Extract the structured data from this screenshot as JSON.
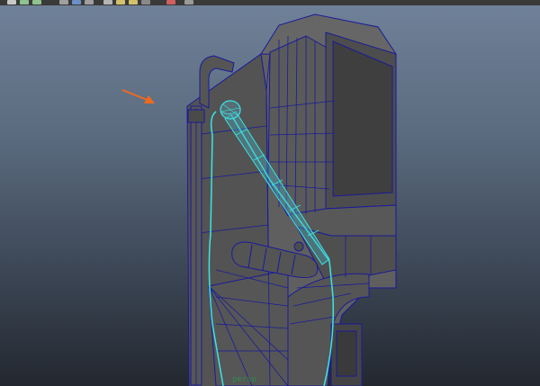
{
  "toolbar": {
    "icons": [
      "shelf-icon-1",
      "shelf-icon-2",
      "shelf-icon-3",
      "display-mode-icon-1",
      "display-mode-icon-2",
      "display-mode-icon-3",
      "lighting-icon-1",
      "lighting-icon-2",
      "lighting-icon-3",
      "camera-icon",
      "isolate-icon",
      "xray-icon"
    ]
  },
  "viewport": {
    "label_text": "persp",
    "colors": {
      "background_top": "#6f8198",
      "background_bottom": "#232830",
      "mesh_face": "#5d5d5d",
      "wireframe": "#1a1a9a",
      "selection": "#39e6e6",
      "screen": "#3f3f3f",
      "annotation_arrow": "#f06a1e"
    }
  }
}
